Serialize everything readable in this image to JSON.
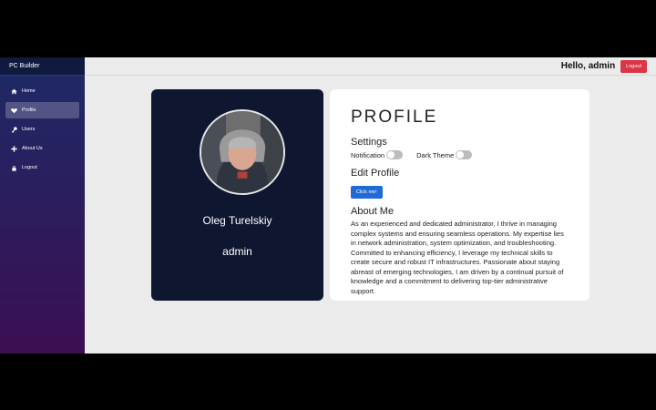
{
  "sidebar": {
    "brand": "PC Builder",
    "items": [
      {
        "label": "Home",
        "icon": "home-icon"
      },
      {
        "label": "Profile",
        "icon": "heart-icon",
        "active": true
      },
      {
        "label": "Users",
        "icon": "key-icon"
      },
      {
        "label": "About Us",
        "icon": "plus-icon"
      },
      {
        "label": "Logout",
        "icon": "lock-icon"
      }
    ]
  },
  "header": {
    "greeting": "Hello, admin",
    "logout_label": "Logout"
  },
  "profile_card": {
    "name": "Oleg Turelskiy",
    "role": "admin"
  },
  "details": {
    "title": "PROFILE",
    "settings_title": "Settings",
    "notification_label": "Notification",
    "dark_theme_label": "Dark Theme",
    "edit_title": "Edit Profile",
    "edit_button": "Click me!",
    "about_title": "About Me",
    "about_text": "As an experienced and dedicated administrator, I thrive in managing complex systems and ensuring seamless operations. My expertise lies in network administration, system optimization, and troubleshooting. Committed to enhancing efficiency, I leverage my technical skills to create secure and robust IT infrastructures. Passionate about staying abreast of emerging technologies, I am driven by a continual pursuit of knowledge and a commitment to delivering top-tier administrative support."
  },
  "colors": {
    "logout_red": "#dc3545",
    "primary_blue": "#1e6bd6",
    "card_dark": "#0f1730"
  }
}
